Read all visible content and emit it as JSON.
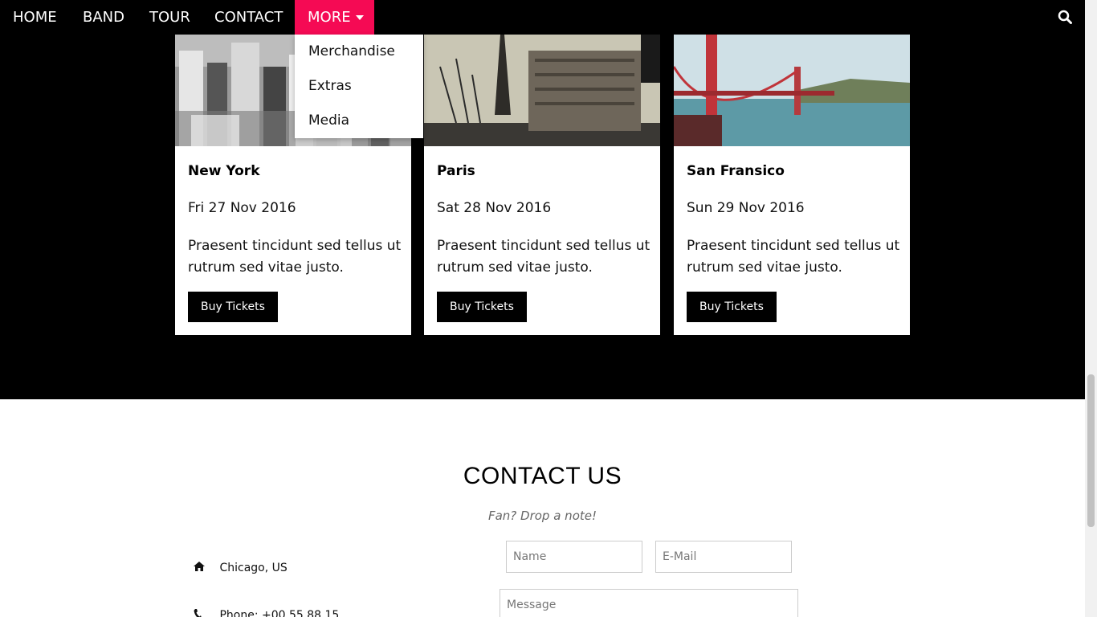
{
  "nav": {
    "items": [
      {
        "label": "HOME"
      },
      {
        "label": "BAND"
      },
      {
        "label": "TOUR"
      },
      {
        "label": "CONTACT"
      }
    ],
    "more_label": "MORE",
    "accent_color": "#f50a54",
    "search_icon": "search-icon"
  },
  "dropdown": {
    "items": [
      {
        "label": "Merchandise"
      },
      {
        "label": "Extras"
      },
      {
        "label": "Media"
      }
    ]
  },
  "tour": {
    "cards": [
      {
        "city": "New York",
        "date": "Fri 27 Nov 2016",
        "desc": "Praesent tincidunt sed tellus ut rutrum sed vitae justo.",
        "button": "Buy Tickets"
      },
      {
        "city": "Paris",
        "date": "Sat 28 Nov 2016",
        "desc": "Praesent tincidunt sed tellus ut rutrum sed vitae justo.",
        "button": "Buy Tickets"
      },
      {
        "city": "San Fransico",
        "date": "Sun 29 Nov 2016",
        "desc": "Praesent tincidunt sed tellus ut rutrum sed vitae justo.",
        "button": "Buy Tickets"
      }
    ]
  },
  "contact": {
    "title": "CONTACT US",
    "subtitle": "Fan? Drop a note!",
    "location": "Chicago, US",
    "phone": "Phone: +00 55 88 15",
    "name_placeholder": "Name",
    "email_placeholder": "E-Mail",
    "message_placeholder": "Message"
  }
}
